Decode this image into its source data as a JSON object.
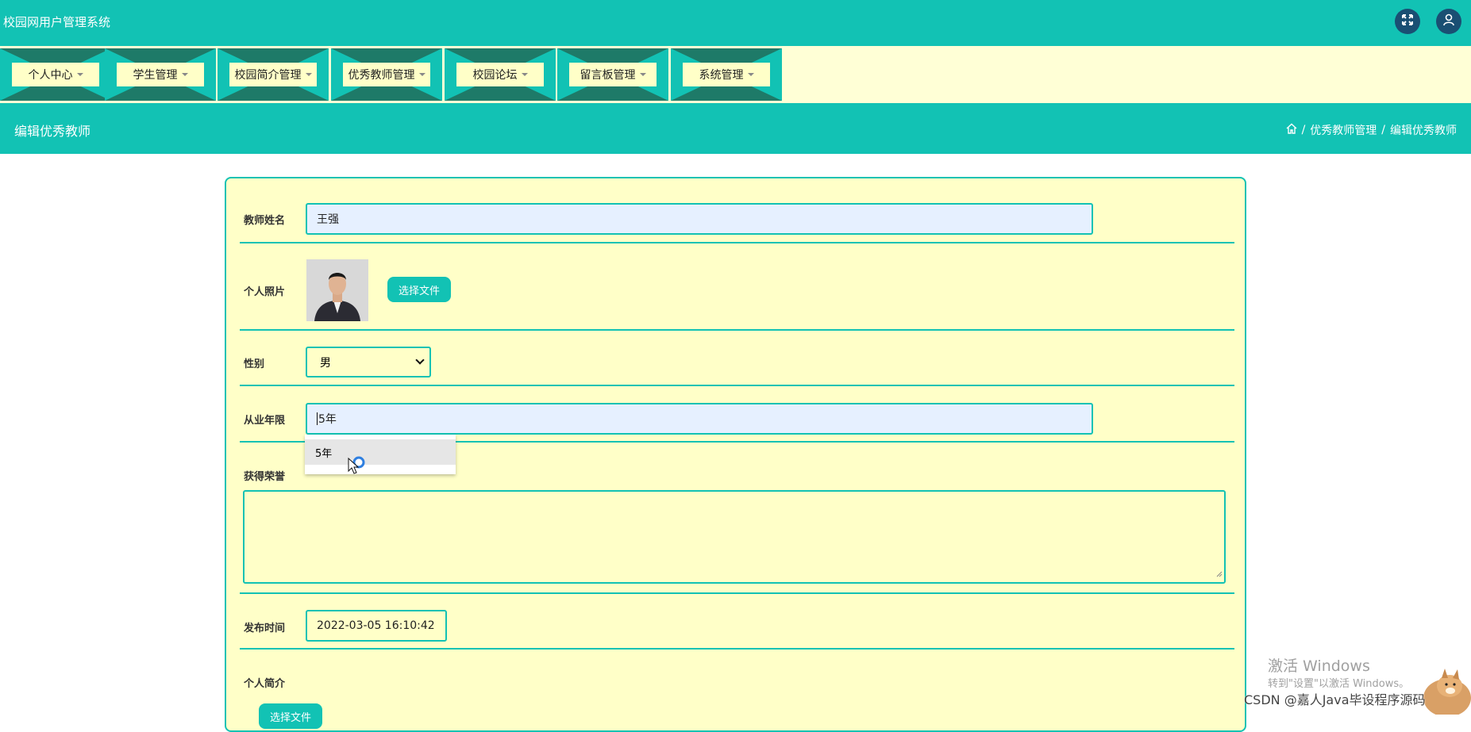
{
  "app": {
    "title": "校园网用户管理系统"
  },
  "nav": [
    {
      "label": "个人中心"
    },
    {
      "label": "学生管理"
    },
    {
      "label": "校园简介管理"
    },
    {
      "label": "优秀教师管理"
    },
    {
      "label": "校园论坛"
    },
    {
      "label": "留言板管理"
    },
    {
      "label": "系统管理"
    }
  ],
  "page": {
    "title": "编辑优秀教师",
    "breadcrumb": [
      "/",
      "优秀教师管理",
      "/",
      "编辑优秀教师"
    ]
  },
  "form": {
    "name_label": "教师姓名",
    "name_value": "王强",
    "photo_label": "个人照片",
    "choose_file": "选择文件",
    "gender_label": "性别",
    "gender_value": "男",
    "years_label": "从业年限",
    "years_value": "5年",
    "years_suggestion": "5年",
    "honors_label": "获得荣誉",
    "publish_label": "发布时间",
    "publish_value": "2022-03-05 16:10:42",
    "intro_label": "个人简介",
    "intro_button": "选择文件"
  },
  "watermarks": {
    "win_title": "激活 Windows",
    "win_sub": "转到\"设置\"以激活 Windows。",
    "csdn": "CSDN @嘉人Java毕设程序源码"
  },
  "colors": {
    "teal": "#12c2b4",
    "nav_dark": "#1e7a68",
    "cream": "#ffffc8",
    "icon_circle": "#1a4f73"
  }
}
